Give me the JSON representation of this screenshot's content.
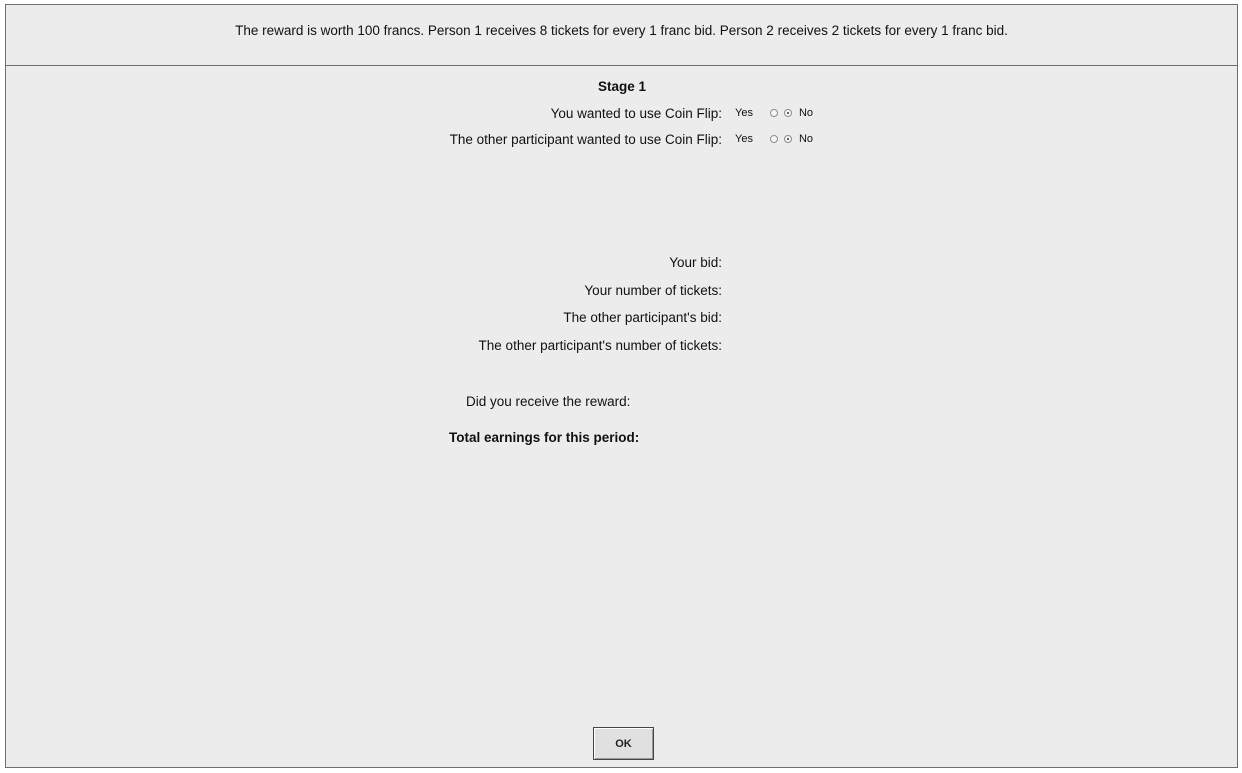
{
  "header": {
    "text": "The reward is worth 100 francs.  Person 1 receives 8 tickets for every 1 franc bid.  Person 2 receives 2 tickets for every 1 franc bid."
  },
  "stage": {
    "title": "Stage 1",
    "coin_flip_rows": [
      {
        "label": "You wanted to use Coin Flip:",
        "yes_label": "Yes",
        "no_label": "No",
        "selected": "No"
      },
      {
        "label": "The other participant wanted to use Coin Flip:",
        "yes_label": "Yes",
        "no_label": "No",
        "selected": "No"
      }
    ]
  },
  "results": {
    "your_bid_label": "Your bid:",
    "your_tickets_label": "Your number of tickets:",
    "other_bid_label": "The other participant's bid:",
    "other_tickets_label": "The other participant's number of tickets:"
  },
  "outcome": {
    "reward_label": "Did you receive the reward:",
    "earnings_label": "Total earnings for this period:"
  },
  "ok_button": {
    "label": "OK"
  }
}
